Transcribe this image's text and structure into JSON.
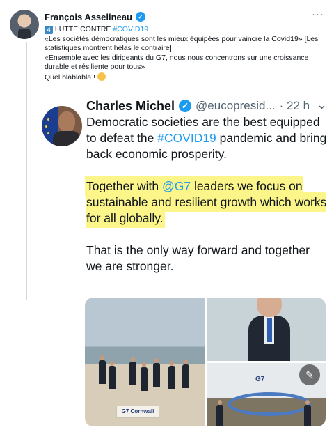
{
  "tweet": {
    "author": "François Asselineau",
    "badge_number": "4",
    "headline": "LUTTE CONTRE",
    "headline_hashtag": "#COVID19",
    "lines": [
      "«Les sociétés démocratiques sont les mieux équipées pour vaincre la Covid19» [Les statistiques montrent hélas le contraire]",
      "«Ensemble avec les dirigeants du G7, nous nous concentrons sur une croissance durable et résiliente pour tous»"
    ],
    "closing": "Quel blablabla !",
    "more_label": "···"
  },
  "quoted": {
    "author": "Charles Michel",
    "handle": "@eucopresid...",
    "time": "· 22 h",
    "more_label": "⌄",
    "para1_before": "Democratic societies are the best equipped to defeat the ",
    "para1_hashtag": "#COVID19",
    "para1_after": " pandemic and bring back economic prosperity.",
    "para2_before": "Together with ",
    "para2_mention": "@G7",
    "para2_after": " leaders we focus on sustainable and resilient growth which works for all globally.",
    "para3": "That is the only way forward and together we are stronger.",
    "highlight_color": "#fbf58a"
  },
  "photos": {
    "sign_text": "G7 Cornwall",
    "wall_text": "G7"
  },
  "colors": {
    "link": "#1d9bf0",
    "verified": "#1d9bf0",
    "muted": "#536471"
  },
  "icons": {
    "verified": "check-badge",
    "more": "ellipsis",
    "edit": "pencil"
  }
}
